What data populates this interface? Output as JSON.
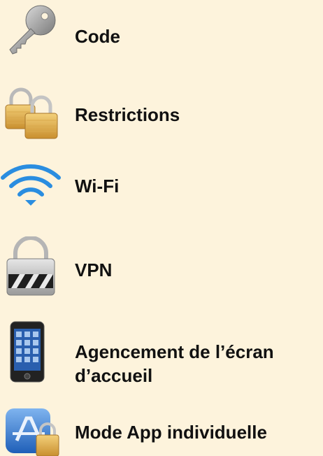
{
  "settings_list": {
    "items": [
      {
        "id": "code",
        "label": "Code",
        "icon": "key-icon"
      },
      {
        "id": "restrictions",
        "label": "Restrictions",
        "icon": "padlocks-icon"
      },
      {
        "id": "wifi",
        "label": "Wi-Fi",
        "icon": "wifi-icon"
      },
      {
        "id": "vpn",
        "label": "VPN",
        "icon": "vpn-lock-icon"
      },
      {
        "id": "home-screen-layout",
        "label_line1": "Agencement de l’écran",
        "label_line2": "d’accueil",
        "icon": "iphone-icon"
      },
      {
        "id": "single-app-mode",
        "label": "Mode App individuelle",
        "icon": "app-store-lock-icon"
      }
    ]
  },
  "colors": {
    "background": "#fdf3dc",
    "text": "#111111",
    "wifi_blue": "#2a8de0"
  }
}
